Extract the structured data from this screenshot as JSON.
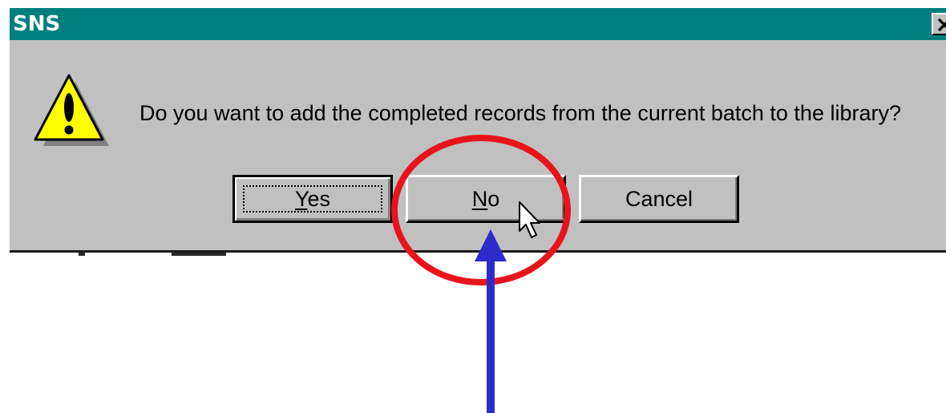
{
  "dialog": {
    "title": "SNS",
    "message": "Do you want to add the completed records from the current batch to the library?",
    "icon": "warning-icon",
    "close_icon": "close-icon",
    "buttons": {
      "yes_mnemonic": "Y",
      "yes_rest": "es",
      "no_mnemonic": "N",
      "no_rest": "o",
      "cancel_label": "Cancel"
    }
  },
  "colors": {
    "titlebar": "#007f7f",
    "dialog_face": "#c0c0c0",
    "annotation_circle": "#e8141c",
    "annotation_arrow": "#2c2ccc",
    "warning_yellow": "#ffff00"
  },
  "annotation": {
    "highlight": "circle around No button",
    "pointer": "arrow pointing up at No button"
  }
}
